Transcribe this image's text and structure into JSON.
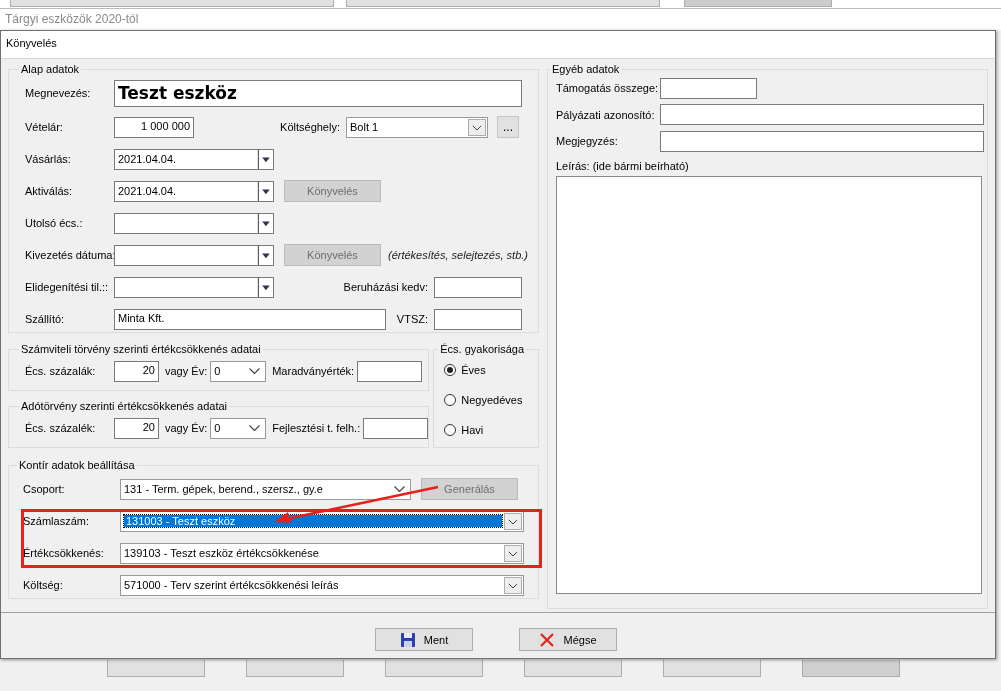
{
  "background": {
    "title": "Tárgyi eszközök 2020-tól"
  },
  "dialog": {
    "title": "Könyvelés"
  },
  "alap": {
    "title": "Alap adatok",
    "megnevezes": {
      "label": "Megnevezés:",
      "value": "Teszt eszköz"
    },
    "vetelar": {
      "label": "Vételár:",
      "value": "1 000 000"
    },
    "koltseghely": {
      "label": "Költséghely:",
      "value": "Bolt 1",
      "button": "..."
    },
    "dates": [
      {
        "label": "Vásárlás:",
        "value": "2021.04.04."
      },
      {
        "label": "Aktiválás:",
        "value": "2021.04.04.",
        "button": {
          "label": "Könyvelés",
          "disabled": true
        }
      },
      {
        "label": "Utolsó écs.:"
      },
      {
        "label": "Kivezetés dátuma:",
        "button": {
          "label": "Könyvelés",
          "disabled": true
        },
        "note": "(értékesítés, selejtezés, stb.)"
      },
      {
        "label": "Elidegenítési til.::",
        "side": {
          "label": "Beruházási kedv:"
        }
      }
    ],
    "szallito": {
      "label": "Szállító:",
      "value": "Minta Kft."
    },
    "vtsz": {
      "label": "VTSZ:"
    }
  },
  "depreciation": [
    {
      "title": "Számviteli törvény szerinti értékcsökkenés adatai",
      "pct_label": "Écs. százalák:",
      "pct": "20",
      "year_label": "vagy Év:",
      "year": "0",
      "extra_label": "Maradványérték:"
    },
    {
      "title": "Adótörvény szerinti értékcsökkenés adatai",
      "pct_label": "Écs. százalék:",
      "pct": "20",
      "year_label": "vagy Év:",
      "year": "0",
      "extra_label": "Fejlesztési t. felh.:"
    }
  ],
  "frequency": {
    "title": "Écs. gyakorisága",
    "options": [
      {
        "label": "Éves",
        "selected": true
      },
      {
        "label": "Negyedéves",
        "selected": false
      },
      {
        "label": "Havi",
        "selected": false
      }
    ]
  },
  "kontir": {
    "title": "Kontír adatok beállítása",
    "rows": [
      {
        "label": "Csoport:",
        "value": "131 - Term. gépek, berend., szersz., gy.e",
        "selected": false,
        "button": {
          "label": "Generálás",
          "disabled": true
        }
      },
      {
        "label": "Számlaszám:",
        "value": "131003 - Teszt eszköz",
        "selected": true
      },
      {
        "label": "Értékcsökkenés:",
        "value": "139103 - Teszt eszköz értékcsökkenése",
        "selected": false
      },
      {
        "label": "Költség:",
        "value": "571000 - Terv szerint értékcsökkenési leírás",
        "selected": false
      }
    ]
  },
  "egyeb": {
    "title": "Egyéb adatok",
    "fields": [
      {
        "label": "Támogatás összege:",
        "kind": "short"
      },
      {
        "label": "Pályázati azonosító:",
        "kind": "long"
      },
      {
        "label": "Megjegyzés:",
        "kind": "long"
      }
    ],
    "leiras": {
      "label": "Leírás: (ide bármi beírható)"
    }
  },
  "footer": [
    {
      "label": "Ment",
      "kind": "save"
    },
    {
      "label": "Mégse",
      "kind": "cancel"
    }
  ]
}
